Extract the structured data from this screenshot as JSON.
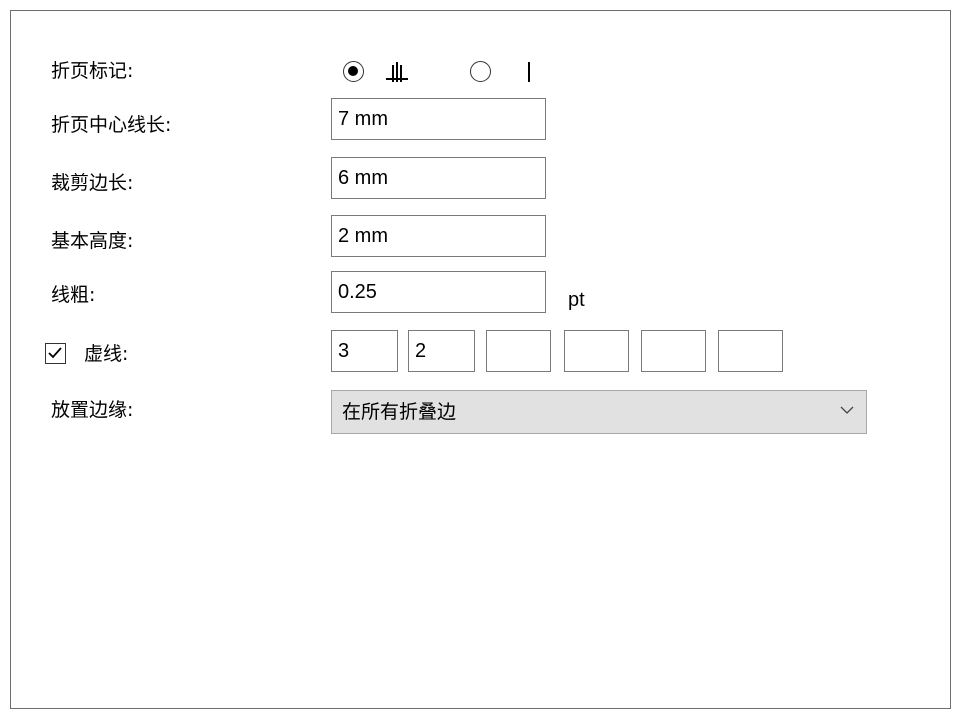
{
  "fold_mark": {
    "label": "折页标记:",
    "options": [
      {
        "icon": "fold-mark-cross-icon",
        "selected": true
      },
      {
        "icon": "fold-mark-line-icon",
        "selected": false
      }
    ]
  },
  "center_line_length": {
    "label": "折页中心线长:",
    "value": "7 mm"
  },
  "cut_edge_length": {
    "label": "裁剪边长:",
    "value": "6 mm"
  },
  "base_height": {
    "label": "基本高度:",
    "value": "2 mm"
  },
  "line_weight": {
    "label": "线粗:",
    "value": "0.25",
    "unit": "pt"
  },
  "dashed": {
    "label": "虚线:",
    "checked": true,
    "values": [
      "3",
      "2",
      "",
      "",
      "",
      ""
    ]
  },
  "placement_edge": {
    "label": "放置边缘:",
    "selected": "在所有折叠边"
  }
}
